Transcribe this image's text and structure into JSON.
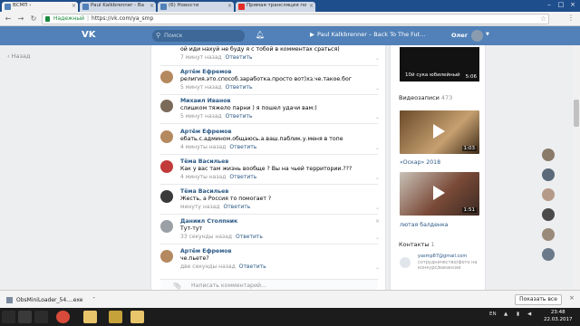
{
  "browser": {
    "tabs": [
      {
        "title": "ВСМП ›",
        "active": true
      },
      {
        "title": "Paul Kalkbrenner - Ba",
        "active": false
      },
      {
        "title": "(6) Новости",
        "active": false
      },
      {
        "title": "Прямая трансляция по",
        "active": false
      }
    ],
    "secure_label": "Надежный",
    "url": "https://vk.com/ya_smp"
  },
  "vk_header": {
    "logo": "VK",
    "search_placeholder": "Поиск",
    "player_track": "Paul Kalkbrenner – Back To The Fut…",
    "user_name": "Олег"
  },
  "left_nav": {
    "back_label": "Назад"
  },
  "comments": [
    {
      "name": "",
      "text": "ой иди нахуй не буду я с тобой в комментах срaться)",
      "time": "7 минут назад",
      "reply": "Ответить"
    },
    {
      "name": "Артём Ефремов",
      "text": "религия.это.способ.заработка.просто вот)хз.че.такое.бог",
      "time": "5 минут назад",
      "reply": "Ответить"
    },
    {
      "name": "Михаил Иванов",
      "text": "слишком тяжело парни ) я пошел удачи вам:)",
      "time": "5 минут назад",
      "reply": "Ответить"
    },
    {
      "name": "Артём Ефремов",
      "text": "ебать.с.админом.общаюсь.а.ваш.паблик.у.меня в топе",
      "time": "4 минуты назад",
      "reply": "Ответить"
    },
    {
      "name": "Тёма Васильев",
      "text": "Как у вас там жизнь вообще ? Вы на чьей территории.???",
      "time": "4 минуты назад",
      "reply": "Ответить"
    },
    {
      "name": "Тёма Васильев",
      "text": "Жесть, а Россия то помогает ?",
      "time": "минуту назад",
      "reply": "Ответить"
    },
    {
      "name": "Даниил Столпник",
      "text": "Тут-тут",
      "time": "33 секунды назад",
      "reply": "Ответить"
    },
    {
      "name": "Артём Ефремов",
      "text": "че.пьете?",
      "time": "две секунды назад",
      "reply": "Ответить"
    }
  ],
  "write_placeholder": "Написать комментарий...",
  "right_col": {
    "top_video_title": "10й сука юбилейный",
    "top_video_duration": "5:06",
    "videos_label": "Видеозаписи",
    "videos_count": "473",
    "videos": [
      {
        "caption": "«Оскар» 2018",
        "duration": "1:03"
      },
      {
        "caption": "лютая балденка",
        "duration": "1:51"
      }
    ],
    "contacts_label": "Контакты",
    "contacts_count": "1",
    "contact_email": "yasmp87@gmail.com",
    "contact_desc": "сотрудничество/фото на конкурс/вакансии"
  },
  "downloads": {
    "file": "ObsMiniLoader_54....exe",
    "show_all": "Показать все"
  },
  "taskbar": {
    "lang": "EN",
    "time": "23:48",
    "date": "22.03.2017"
  }
}
